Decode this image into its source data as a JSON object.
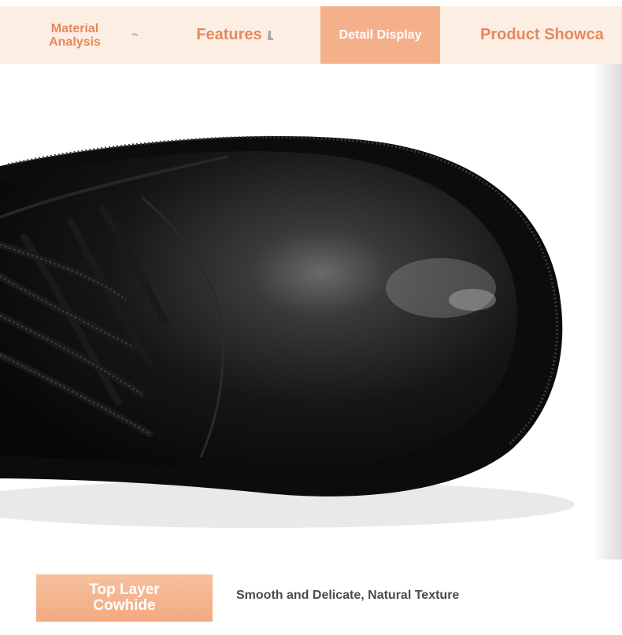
{
  "tabs": {
    "material": "Material Analysis",
    "features": "Features",
    "detail": "Detail Display",
    "product": "Product Showca"
  },
  "caption": {
    "badge": "Top Layer Cowhide",
    "description": "Smooth and Delicate, Natural Texture"
  },
  "hero": {
    "icon": "leather-boot-photo"
  },
  "colors": {
    "accent": "#e6885c",
    "tab_active_bg": "#f4b08a",
    "tabbar_bg": "#fdeee4",
    "badge_bg": "#f3aa80"
  }
}
